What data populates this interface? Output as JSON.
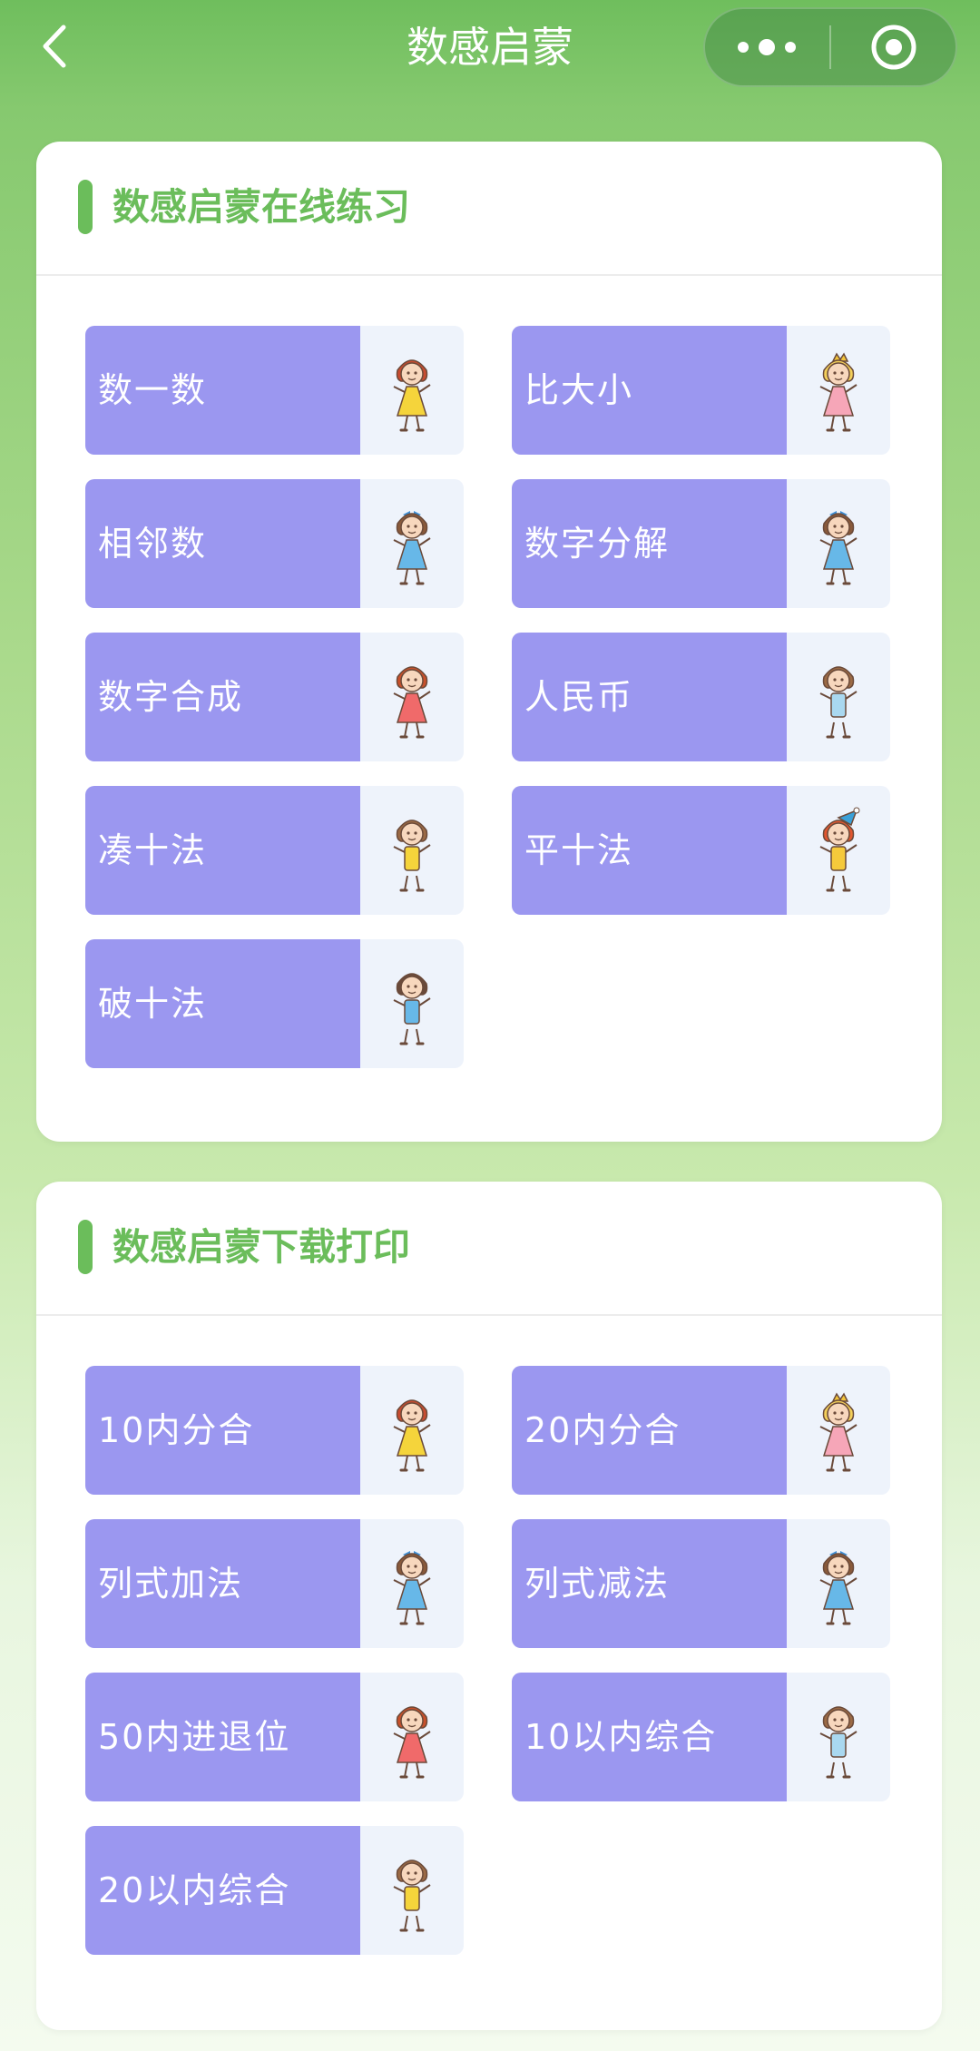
{
  "header": {
    "title": "数感启蒙",
    "back_icon": "chevron-left-icon",
    "more_icon": "more-dots-icon",
    "target_icon": "target-icon"
  },
  "sections": [
    {
      "title": "数感启蒙在线练习",
      "items": [
        {
          "label": "数一数",
          "icon": "girl-yellow-dress-icon"
        },
        {
          "label": "比大小",
          "icon": "princess-pink-dress-icon"
        },
        {
          "label": "相邻数",
          "icon": "girl-blue-dress-icon"
        },
        {
          "label": "数字分解",
          "icon": "girl-blue-dress-icon"
        },
        {
          "label": "数字合成",
          "icon": "girl-red-dress-icon"
        },
        {
          "label": "人民币",
          "icon": "boy-light-blue-icon"
        },
        {
          "label": "凑十法",
          "icon": "boy-yellow-shirt-icon"
        },
        {
          "label": "平十法",
          "icon": "clown-kid-icon"
        },
        {
          "label": "破十法",
          "icon": "boy-jumping-icon"
        }
      ]
    },
    {
      "title": "数感启蒙下载打印",
      "items": [
        {
          "label": "10内分合",
          "icon": "girl-yellow-dress-icon"
        },
        {
          "label": "20内分合",
          "icon": "princess-pink-dress-icon"
        },
        {
          "label": "列式加法",
          "icon": "girl-blue-dress-icon"
        },
        {
          "label": "列式减法",
          "icon": "girl-blue-dress-icon"
        },
        {
          "label": "50内进退位",
          "icon": "girl-red-dress-icon"
        },
        {
          "label": "10以内综合",
          "icon": "boy-light-blue-icon"
        },
        {
          "label": "20以内综合",
          "icon": "boy-yellow-shirt-icon"
        }
      ]
    }
  ],
  "colors": {
    "accent_green": "#6bbd5b",
    "tile_purple": "#9b97f0",
    "tile_image_bg": "#eef3fb"
  }
}
